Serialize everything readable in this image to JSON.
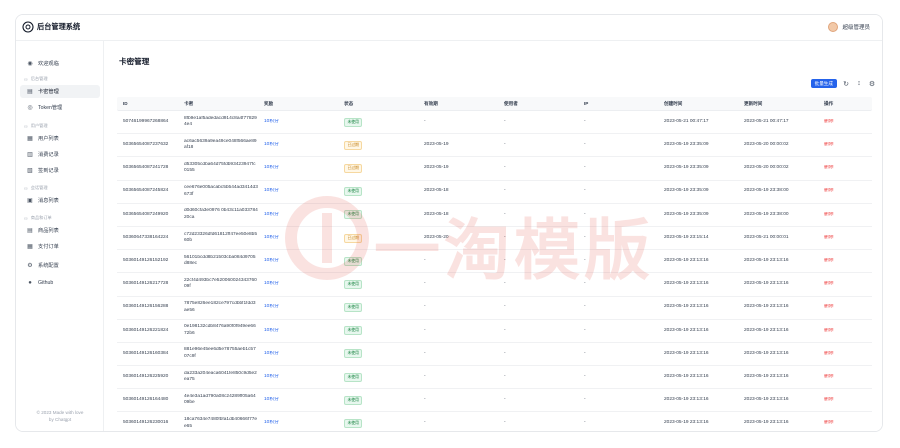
{
  "app": {
    "title": "后台管理系统",
    "user_name": "超级管理员"
  },
  "sidebar": {
    "items": [
      {
        "label": "欢迎观临",
        "icon": "dashboard-icon"
      },
      {
        "group": "后台管理"
      },
      {
        "label": "卡密管理",
        "icon": "card-icon",
        "active": true
      },
      {
        "label": "Token管理",
        "icon": "token-icon"
      },
      {
        "group": "用户管理"
      },
      {
        "label": "用户列表",
        "icon": "user-list-icon"
      },
      {
        "label": "消费记录",
        "icon": "consume-icon"
      },
      {
        "label": "签到记录",
        "icon": "checkin-icon"
      },
      {
        "group": "会话管理"
      },
      {
        "label": "消息列表",
        "icon": "message-icon"
      },
      {
        "group": "商品和订单"
      },
      {
        "label": "商品列表",
        "icon": "product-icon"
      },
      {
        "label": "支付订单",
        "icon": "order-icon"
      },
      {
        "label": "系统配置",
        "icon": "gear-icon"
      },
      {
        "label": "Github",
        "icon": "github-icon"
      }
    ],
    "footer_line1": "© 2023 Made with love",
    "footer_line2": "by Chatgpt"
  },
  "main": {
    "title": "卡密管理",
    "batch_label": "批量生成",
    "toolbar_icons": [
      "refresh-icon",
      "column-height-icon",
      "settings-icon"
    ]
  },
  "table": {
    "columns": [
      "ID",
      "卡密",
      "奖励",
      "状态",
      "有效期",
      "使用者",
      "IP",
      "创建时间",
      "更新时间",
      "操作"
    ],
    "rows": [
      {
        "id": "50746199967268864",
        "key": "8fb9e1af5adedacd914c8a4f778294e4",
        "reward": "10积分",
        "status": "未使用",
        "status_type": "unused",
        "valid": "-",
        "user": "-",
        "ip": "-",
        "created": "2023-05-21 00:47:17",
        "updated": "2023-05-21 00:47:17",
        "op": "删除"
      },
      {
        "id": "50365654087237632",
        "key": "ac6ac5639a9ea49ce048f566ae89af18",
        "reward": "10积分",
        "status": "已过期",
        "status_type": "expired",
        "valid": "2023-05-19",
        "user": "-",
        "ip": "-",
        "created": "2023-05-19 23:35:09",
        "updated": "2023-05-20 00:00:02",
        "op": "删除"
      },
      {
        "id": "50365654087241728",
        "key": "d53305cdba64d75fdb93423947fc0155",
        "reward": "10积分",
        "status": "已过期",
        "status_type": "expired",
        "valid": "2023-05-19",
        "user": "-",
        "ip": "-",
        "created": "2023-05-19 23:35:09",
        "updated": "2023-05-20 00:00:02",
        "op": "删除"
      },
      {
        "id": "50365654087245824",
        "key": "cee676e005acabc5b544ad3414d3673f",
        "reward": "10积分",
        "status": "未使用",
        "status_type": "unused",
        "valid": "2023-05-18",
        "user": "-",
        "ip": "-",
        "created": "2023-05-19 23:35:09",
        "updated": "2023-05-19 23:38:00",
        "op": "删除"
      },
      {
        "id": "50365654087249920",
        "key": "d0d60cfa3e0976 0b43c11a03378420ca",
        "reward": "10积分",
        "status": "未使用",
        "status_type": "unused",
        "valid": "2023-05-18",
        "user": "-",
        "ip": "-",
        "created": "2023-05-19 23:35:09",
        "updated": "2023-05-19 23:38:00",
        "op": "删除"
      },
      {
        "id": "50360647338164224",
        "key": "c72d23326dfd61812ff47ee50e8b560b",
        "reward": "10积分",
        "status": "已过期",
        "status_type": "expired",
        "valid": "2023-05-20",
        "user": "-",
        "ip": "-",
        "created": "2023-05-19 23:15:14",
        "updated": "2023-05-21 00:00:01",
        "op": "删除"
      },
      {
        "id": "50360149126152192",
        "key": "56101bcdd8b21503cba084d9705d88ec",
        "reward": "10积分",
        "status": "未使用",
        "status_type": "unused",
        "valid": "-",
        "user": "-",
        "ip": "-",
        "created": "2023-05-19 23:13:16",
        "updated": "2023-05-19 23:13:16",
        "op": "删除"
      },
      {
        "id": "50360149126217728",
        "key": "22cf4d493bc7e52006002434376009f",
        "reward": "10积分",
        "status": "未使用",
        "status_type": "unused",
        "valid": "-",
        "user": "-",
        "ip": "-",
        "created": "2023-05-19 23:13:16",
        "updated": "2023-05-19 23:13:16",
        "op": "删除"
      },
      {
        "id": "50360149126156288",
        "key": "7875e826ee182ce797cdbbf1fdd3ae56",
        "reward": "10积分",
        "status": "未使用",
        "status_type": "unused",
        "valid": "-",
        "user": "-",
        "ip": "-",
        "created": "2023-05-19 23:13:16",
        "updated": "2023-05-19 23:13:16",
        "op": "删除"
      },
      {
        "id": "50360149126221824",
        "key": "0e198132cdb8476a90f0f949ee6672b6",
        "reward": "10积分",
        "status": "未使用",
        "status_type": "unused",
        "valid": "-",
        "user": "-",
        "ip": "-",
        "created": "2023-05-19 23:13:16",
        "updated": "2023-05-19 23:13:16",
        "op": "删除"
      },
      {
        "id": "50360149126160384",
        "key": "881e96e45ee6d5e78755aeb1c5707c9f",
        "reward": "10积分",
        "status": "未使用",
        "status_type": "unused",
        "valid": "-",
        "user": "-",
        "ip": "-",
        "created": "2023-05-19 23:13:16",
        "updated": "2023-05-19 23:13:16",
        "op": "删除"
      },
      {
        "id": "50360149126225920",
        "key": "da233a204eaca6041fe850c9d5e2ea75",
        "reward": "10积分",
        "status": "未使用",
        "status_type": "unused",
        "valid": "-",
        "user": "-",
        "ip": "-",
        "created": "2023-05-19 23:13:16",
        "updated": "2023-05-19 23:13:16",
        "op": "删除"
      },
      {
        "id": "50360149126164480",
        "key": "4e4e3a1ad790a08c24289ff05a6409be",
        "reward": "10积分",
        "status": "未使用",
        "status_type": "unused",
        "valid": "-",
        "user": "-",
        "ip": "-",
        "created": "2023-05-19 23:13:16",
        "updated": "2023-05-19 23:13:16",
        "op": "删除"
      },
      {
        "id": "50360149126230016",
        "key": "18ca7634e7480fbfa1db40666f77ee65",
        "reward": "10积分",
        "status": "未使用",
        "status_type": "unused",
        "valid": "-",
        "user": "-",
        "ip": "-",
        "created": "2023-05-19 23:13:16",
        "updated": "2023-05-19 23:13:16",
        "op": "删除"
      }
    ]
  },
  "watermark": {
    "text": "一淘模版",
    "color": "#e03a2f"
  },
  "colors": {
    "primary": "#2563eb",
    "danger": "#ef4444",
    "success": "#15803d",
    "warning": "#c27c0e"
  }
}
